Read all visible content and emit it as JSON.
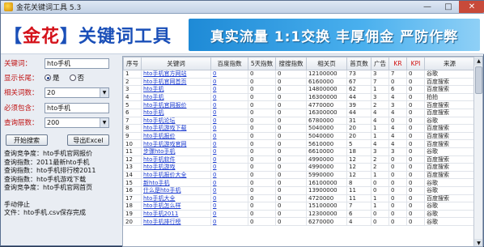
{
  "window": {
    "title": "金花关键词工具 5.3",
    "minimize": "—",
    "maximize": "□",
    "close": "✕"
  },
  "banner": {
    "logo_left": "【",
    "logo_name": "金花",
    "logo_right": "】",
    "logo_rest": "关键词工具",
    "slogan": "真实流量 1:1交换 丰厚佣金 严防作弊"
  },
  "form": {
    "keyword_label": "关键词：",
    "keyword_value": "hto手机",
    "display_label": "显示长尾：",
    "display_yes": "是",
    "display_no": "否",
    "display_selected": "是",
    "related_label": "相关词数：",
    "related_value": "20",
    "filter_label": "必须包含：",
    "filter_value": "hto手机",
    "depth_label": "查询层数：",
    "depth_value": "200",
    "start_button": "开始搜索",
    "export_button": "导出Excel"
  },
  "log": [
    "查询竞争度：hto手机官网报价",
    "查询指数：2011最新hto手机",
    "查询指数：hto手机排行榜2011",
    "查询指数：hto手机游戏下载",
    "查询竞争度：hto手机官网首页",
    "",
    "手动停止",
    "文件：hto手机.csv保存完成"
  ],
  "table": {
    "headers": [
      "序号",
      "关键词",
      "百度指数",
      "5天指数",
      "搜搜指数",
      "相关页",
      "首页数",
      "广告",
      "KR",
      "KPI",
      "来源"
    ],
    "rows": [
      [
        "1",
        "hto手机官方网站",
        "0",
        "0",
        "0",
        "12100000",
        "73",
        "3",
        "7",
        "0",
        "谷歌"
      ],
      [
        "2",
        "hto手机官网首页",
        "0",
        "0",
        "0",
        "6160000",
        "67",
        "7",
        "0",
        "0",
        "百度搜索"
      ],
      [
        "3",
        "hto手机",
        "0",
        "0",
        "0",
        "14800000",
        "62",
        "1",
        "6",
        "0",
        "百度搜索"
      ],
      [
        "4",
        "hto手机",
        "0",
        "0",
        "0",
        "16300000",
        "44",
        "3",
        "4",
        "0",
        "拍拍"
      ],
      [
        "5",
        "hto手机官网报价",
        "0",
        "0",
        "0",
        "4770000",
        "39",
        "2",
        "3",
        "0",
        "百度搜索"
      ],
      [
        "6",
        "hto手机",
        "0",
        "0",
        "0",
        "16300000",
        "44",
        "4",
        "4",
        "0",
        "百度搜索"
      ],
      [
        "7",
        "hto手机论坛",
        "0",
        "0",
        "0",
        "6780000",
        "31",
        "4",
        "0",
        "0",
        "谷歌"
      ],
      [
        "8",
        "hto手机游戏下载",
        "0",
        "0",
        "0",
        "5040000",
        "20",
        "1",
        "4",
        "0",
        "百度搜索"
      ],
      [
        "9",
        "hto手机报价",
        "0",
        "0",
        "0",
        "5040000",
        "20",
        "1",
        "4",
        "0",
        "百度搜索"
      ],
      [
        "10",
        "hto手机游戏官网",
        "0",
        "0",
        "0",
        "5610000",
        "5",
        "4",
        "4",
        "0",
        "百度搜索"
      ],
      [
        "11",
        "步骤hto手机",
        "0",
        "0",
        "0",
        "6610000",
        "18",
        "3",
        "3",
        "0",
        "谷歌"
      ],
      [
        "12",
        "hto手机软件",
        "0",
        "0",
        "0",
        "4990000",
        "12",
        "2",
        "0",
        "0",
        "百度搜索"
      ],
      [
        "13",
        "hto手机游戏",
        "0",
        "0",
        "0",
        "4990000",
        "12",
        "2",
        "0",
        "0",
        "百度搜索"
      ],
      [
        "14",
        "hto手机报价大全",
        "0",
        "0",
        "0",
        "5990000",
        "12",
        "1",
        "0",
        "0",
        "百度搜索"
      ],
      [
        "15",
        "新hto手机",
        "0",
        "0",
        "0",
        "16100000",
        "8",
        "0",
        "0",
        "0",
        "谷歌"
      ],
      [
        "16",
        "什么是hto手机",
        "0",
        "0",
        "0",
        "13900000",
        "11",
        "0",
        "0",
        "0",
        "谷歌"
      ],
      [
        "17",
        "hto手机大全",
        "0",
        "0",
        "0",
        "4720000",
        "11",
        "1",
        "0",
        "0",
        "百度搜索"
      ],
      [
        "18",
        "hto手机怎么样",
        "0",
        "0",
        "0",
        "15100000",
        "7",
        "1",
        "0",
        "0",
        "谷歌"
      ],
      [
        "19",
        "hto手机2011",
        "0",
        "0",
        "0",
        "12300000",
        "6",
        "0",
        "0",
        "0",
        "谷歌"
      ],
      [
        "20",
        "hto手机排行榜",
        "0",
        "0",
        "0",
        "6270000",
        "4",
        "0",
        "0",
        "0",
        "谷歌"
      ]
    ]
  }
}
